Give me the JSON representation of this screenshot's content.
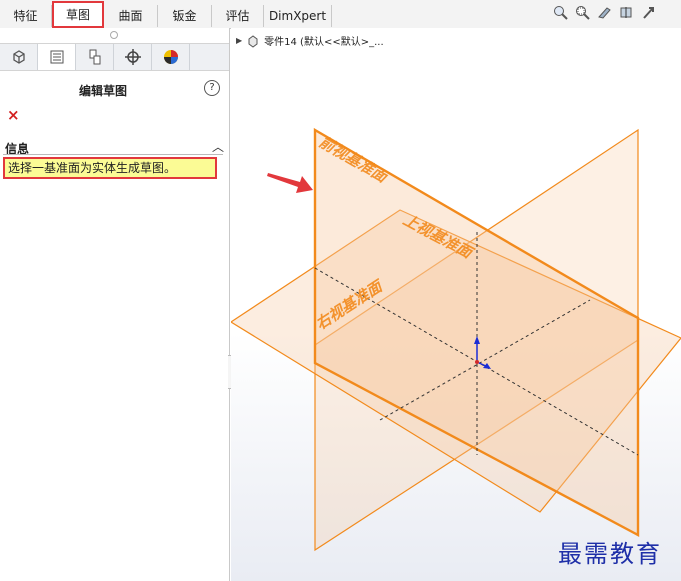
{
  "tabs": [
    {
      "label": "特征",
      "active": false
    },
    {
      "label": "草图",
      "active": true
    },
    {
      "label": "曲面",
      "active": false
    },
    {
      "label": "钣金",
      "active": false
    },
    {
      "label": "评估",
      "active": false
    },
    {
      "label": "DimXpert",
      "active": false
    }
  ],
  "manager_tabs": [
    "feature-manager-icon",
    "property-manager-icon",
    "configuration-manager-icon",
    "dimxpert-manager-icon",
    "display-manager-icon"
  ],
  "panel": {
    "title": "编辑草图",
    "help": "?",
    "close": "×",
    "info_heading": "信息",
    "info_text": "选择一基准面为实体生成草图。"
  },
  "tree": {
    "label": "零件14  (默认<<默认>_..."
  },
  "planes": {
    "front": "前视基准面",
    "top": "上视基准面",
    "right": "右视基准面"
  },
  "watermark": "最需教育",
  "colors": {
    "plane_edge": "#f28a1c",
    "plane_fill": "#f7c89e",
    "highlight": "#e2383c",
    "info_bg": "#fbfb95"
  }
}
